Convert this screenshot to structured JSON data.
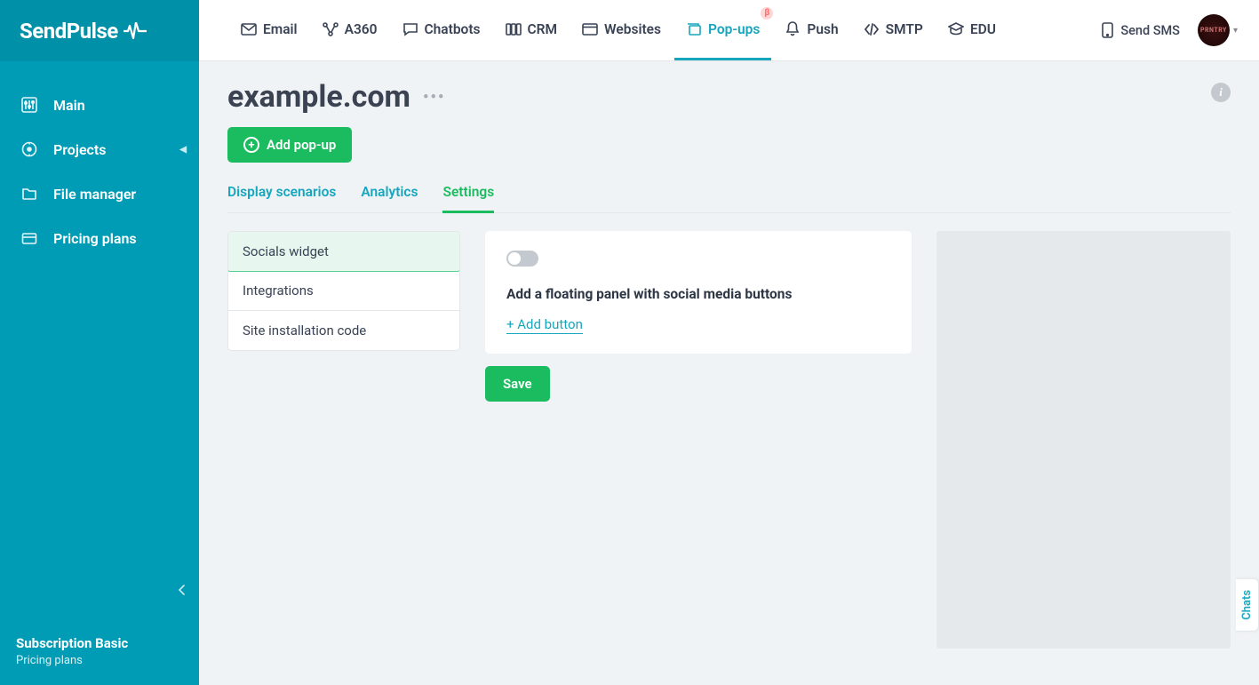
{
  "brand": "SendPulse",
  "sidebar": {
    "items": [
      {
        "label": "Main"
      },
      {
        "label": "Projects"
      },
      {
        "label": "File manager"
      },
      {
        "label": "Pricing plans"
      }
    ],
    "subscription_label": "Subscription Basic",
    "subscription_link": "Pricing plans"
  },
  "topnav": {
    "items": [
      {
        "label": "Email"
      },
      {
        "label": "A360"
      },
      {
        "label": "Chatbots"
      },
      {
        "label": "CRM"
      },
      {
        "label": "Websites"
      },
      {
        "label": "Pop-ups",
        "badge": "β",
        "active": true
      },
      {
        "label": "Push"
      },
      {
        "label": "SMTP"
      },
      {
        "label": "EDU"
      }
    ],
    "sms_label": "Send SMS"
  },
  "page": {
    "title": "example.com",
    "add_button": "Add pop-up",
    "tabs": [
      {
        "label": "Display scenarios"
      },
      {
        "label": "Analytics"
      },
      {
        "label": "Settings",
        "active": true
      }
    ],
    "settings_nav": [
      {
        "label": "Socials widget",
        "active": true
      },
      {
        "label": "Integrations"
      },
      {
        "label": "Site installation code"
      }
    ],
    "panel": {
      "toggle_on": false,
      "heading": "Add a floating panel with social media buttons",
      "add_link": "+ Add button",
      "save": "Save"
    }
  },
  "chats_tab": "Chats"
}
